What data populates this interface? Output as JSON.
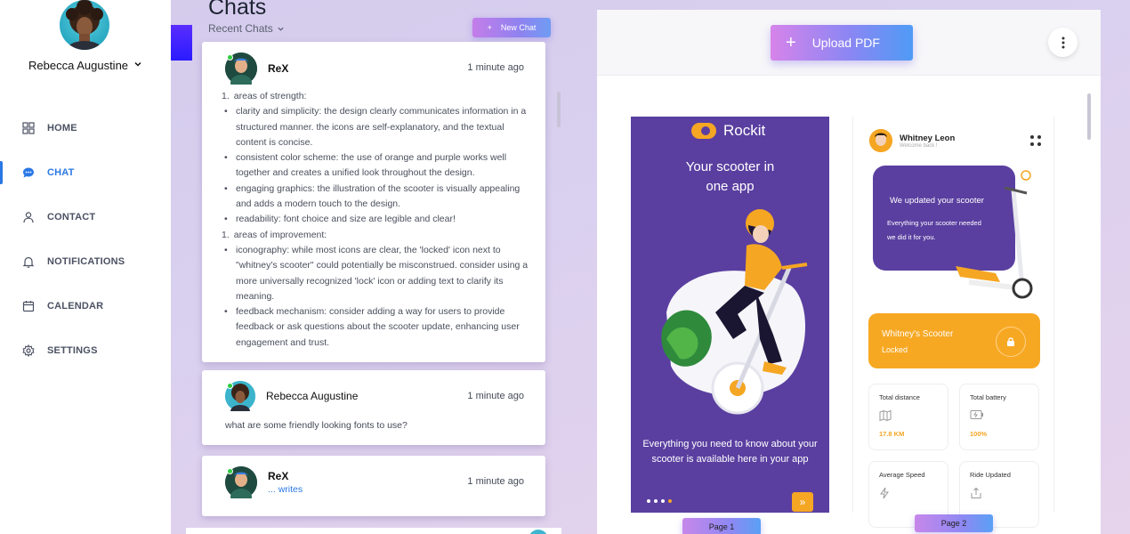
{
  "user": {
    "name": "Rebecca Augustine"
  },
  "nav": {
    "items": [
      {
        "label": "HOME",
        "icon": "grid-icon"
      },
      {
        "label": "CHAT",
        "icon": "chat-bubble-icon"
      },
      {
        "label": "CONTACT",
        "icon": "person-icon"
      },
      {
        "label": "NOTIFICATIONS",
        "icon": "bell-icon"
      },
      {
        "label": "CALENDAR",
        "icon": "calendar-icon"
      },
      {
        "label": "SETTINGS",
        "icon": "gear-icon"
      }
    ],
    "active": "CHAT"
  },
  "chats": {
    "title": "Chats",
    "filter_label": "Recent Chats",
    "new_chat_label": "New Chat",
    "cards": [
      {
        "sender": "ReX",
        "time": "1 minute ago",
        "online": true,
        "lines": [
          {
            "marker": "1.",
            "text": "areas of strength:"
          },
          {
            "marker": "•",
            "text": "clarity and simplicity: the design clearly communicates information in a structured manner. the icons are self-explanatory, and the textual content is concise."
          },
          {
            "marker": "•",
            "text": "consistent color scheme: the use of orange and purple works well together and creates a unified look throughout the design."
          },
          {
            "marker": "•",
            "text": "engaging graphics: the illustration of the scooter is visually appealing and adds a modern touch to the design."
          },
          {
            "marker": "•",
            "text": "readability: font choice and size are legible and clear!"
          },
          {
            "marker": "1.",
            "text": "areas of improvement:"
          },
          {
            "marker": "•",
            "text": "iconography: while most icons are clear, the 'locked' icon next to \"whitney's scooter\" could potentially be misconstrued. consider using a more universally recognized 'lock' icon or adding text to clarify its meaning."
          },
          {
            "marker": "•",
            "text": "feedback mechanism: consider adding a way for users to provide feedback or ask questions about the scooter update, enhancing user engagement and trust."
          }
        ]
      },
      {
        "sender": "Rebecca Augustine",
        "time": "1 minute ago",
        "online": true,
        "message": "what are some friendly looking fonts to use?"
      },
      {
        "sender": "ReX",
        "time": "1 minute ago",
        "online": true,
        "status": "writes",
        "status_prefix": "..."
      }
    ]
  },
  "pdf": {
    "upload_label": "Upload PDF",
    "page_labels": [
      "Page 1",
      "Page 2"
    ],
    "page1": {
      "brand": "Rockit",
      "title_line1": "Your scooter in",
      "title_line2": "one app",
      "description": "Everything you need to know about your scooter is available here in your app"
    },
    "page2": {
      "user_name": "Whitney Leon",
      "user_sub": "Welcome back !",
      "promo_title": "We updated your scooter",
      "promo_line1": "Everything your scooter needed",
      "promo_line2": "we did it for you.",
      "scooter_title": "Whitney's Scooter",
      "scooter_status": "Locked",
      "stats": [
        {
          "label": "Total distance",
          "value": "17.8 KM"
        },
        {
          "label": "Total battery",
          "value": "100%"
        },
        {
          "label": "Average Speed",
          "value": ""
        },
        {
          "label": "Ride Updated",
          "value": ""
        }
      ]
    }
  },
  "colors": {
    "accent_blue": "#2a78e4",
    "rockit_purple": "#5a3fa0",
    "rockit_orange": "#f5a623",
    "online_green": "#2ecc40"
  }
}
